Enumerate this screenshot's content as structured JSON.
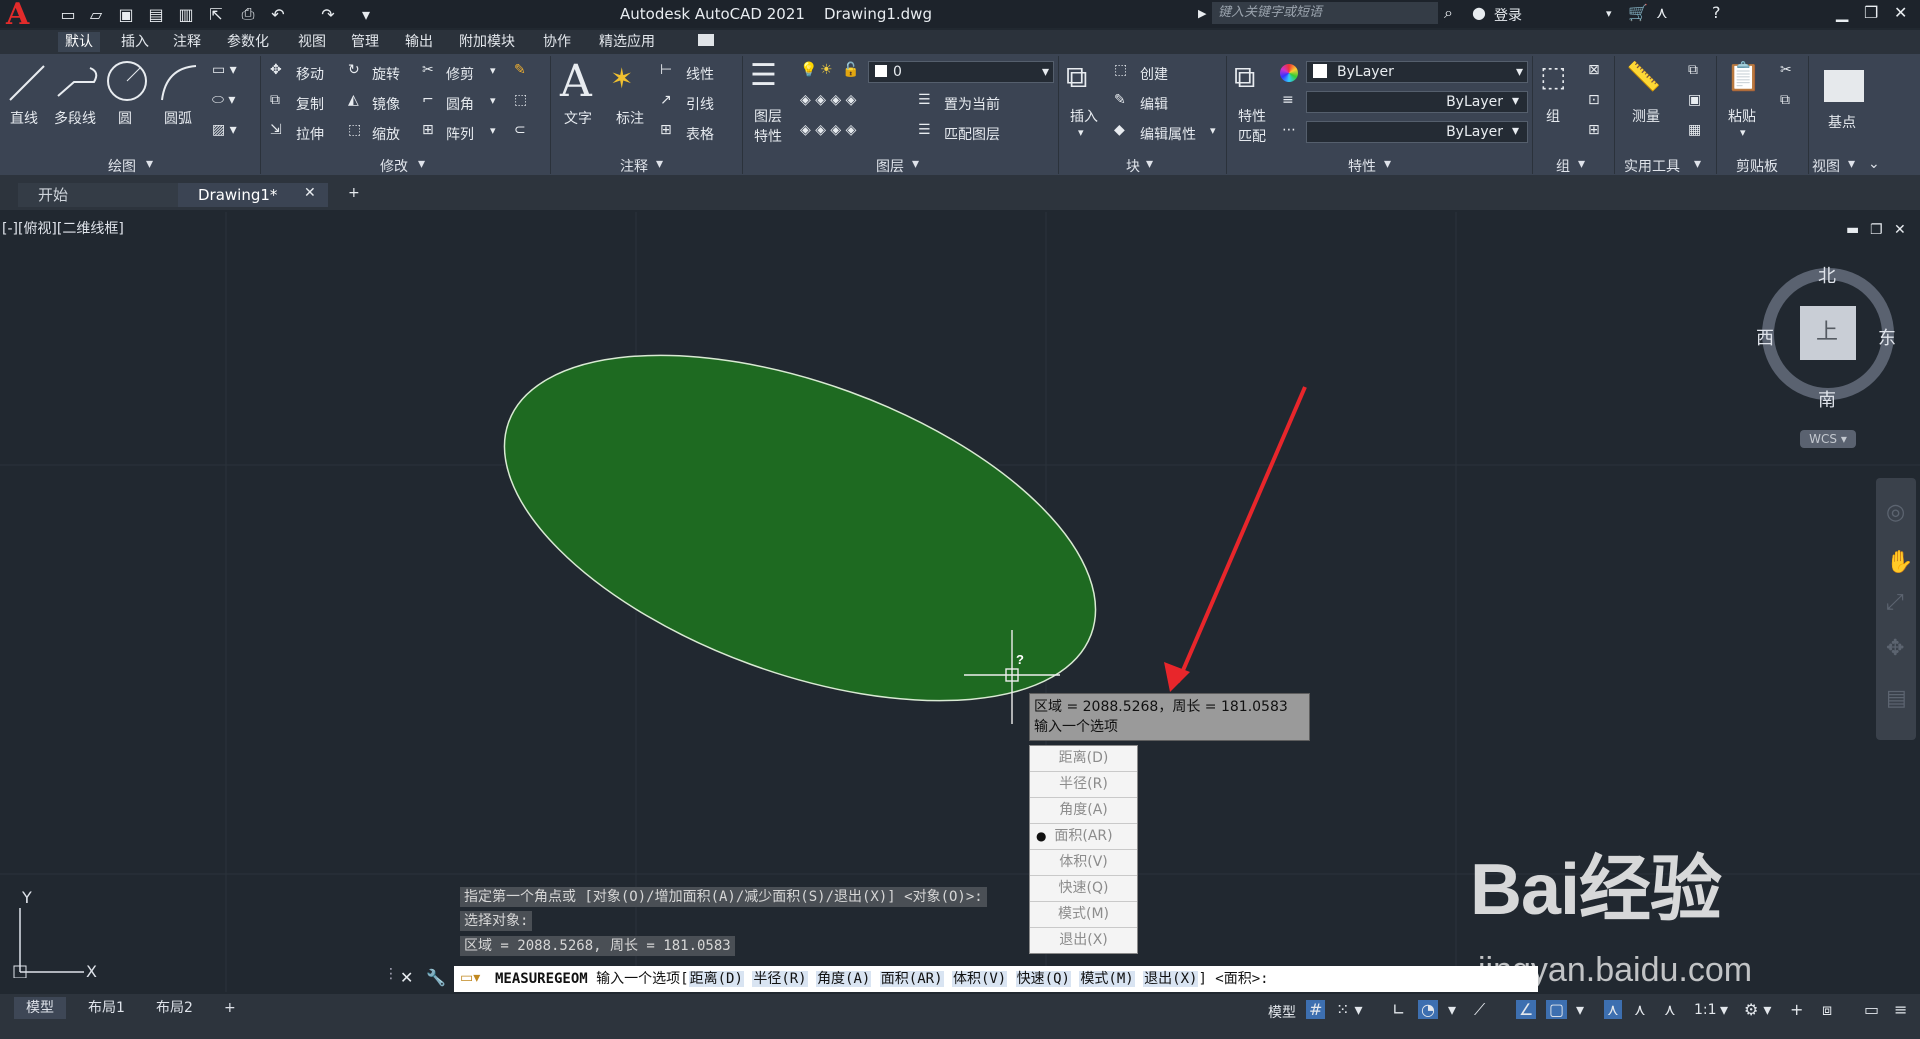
{
  "app": {
    "title": "Autodesk AutoCAD 2021    Drawing1.dwg",
    "logo": "A"
  },
  "search": {
    "placeholder": "键入关键字或短语"
  },
  "user": {
    "login": "登录"
  },
  "ribbon_tabs": [
    "默认",
    "插入",
    "注释",
    "参数化",
    "视图",
    "管理",
    "输出",
    "附加模块",
    "协作",
    "精选应用"
  ],
  "draw_panel": {
    "title": "绘图",
    "tools": [
      "直线",
      "多段线",
      "圆",
      "圆弧"
    ]
  },
  "modify_panel": {
    "title": "修改",
    "tools": [
      "移动",
      "旋转",
      "修剪",
      "复制",
      "镜像",
      "圆角",
      "拉伸",
      "缩放",
      "阵列"
    ]
  },
  "annotation_panel": {
    "title": "注释",
    "tools": [
      "文字",
      "标注",
      "线性",
      "引线",
      "表格"
    ]
  },
  "layers_panel": {
    "title": "图层",
    "layer_props": "图层",
    "layer_props2": "特性",
    "current_layer": "0",
    "set_current": "置为当前",
    "match_layer": "匹配图层"
  },
  "block_panel": {
    "title": "块",
    "insert": "插入",
    "create": "创建",
    "edit": "编辑",
    "edit_attr": "编辑属性"
  },
  "properties_panel": {
    "title": "特性",
    "match": "特性",
    "match2": "匹配",
    "color": "ByLayer",
    "linetype": "ByLayer",
    "lineweight": "ByLayer"
  },
  "group_panel": {
    "title": "组",
    "label": "组"
  },
  "utilities_panel": {
    "title": "实用工具",
    "label": "测量"
  },
  "clipboard_panel": {
    "title": "剪贴板",
    "label": "粘贴"
  },
  "view_panel": {
    "title": "视图",
    "label": "基点"
  },
  "doc_tabs": {
    "start": "开始",
    "drawing": "Drawing1*"
  },
  "viewport": {
    "label": "[-][俯视][二维线框]"
  },
  "viewcube": {
    "north": "北",
    "south": "南",
    "east": "东",
    "west": "西",
    "top": "上",
    "wcs": "WCS"
  },
  "ucs": {
    "x": "X",
    "y": "Y"
  },
  "tooltip": {
    "line1": "区域 = 2088.5268，周长 = 181.0583",
    "line2": "输入一个选项"
  },
  "options_menu": [
    "距离(D)",
    "半径(R)",
    "角度(A)",
    "面积(AR)",
    "体积(V)",
    "快速(Q)",
    "模式(M)",
    "退出(X)"
  ],
  "options_selected": "面积(AR)",
  "history": [
    "指定第一个角点或 [对象(O)/增加面积(A)/减少面积(S)/退出(X)] <对象(O)>:",
    "选择对象:",
    "区域 = 2088.5268, 周长 = 181.0583"
  ],
  "command": {
    "name": "MEASUREGEOM",
    "prompt": "输入一个选项[",
    "opts": [
      "距离(D)",
      "半径(R)",
      "角度(A)",
      "面积(AR)",
      "体积(V)",
      "快速(Q)",
      "模式(M)",
      "退出(X)"
    ],
    "tail": "] <面积>:"
  },
  "layout_tabs": [
    "模型",
    "布局1",
    "布局2"
  ],
  "status": {
    "model": "模型",
    "scale": "1:1"
  },
  "watermark": {
    "text": "Bai经验",
    "url": "jingyan.baidu.com"
  },
  "colors": {
    "ellipse_fill": "#1e6a21",
    "ellipse_stroke": "#d9ead3",
    "arrow": "#e8262b",
    "canvas": "#212830"
  }
}
